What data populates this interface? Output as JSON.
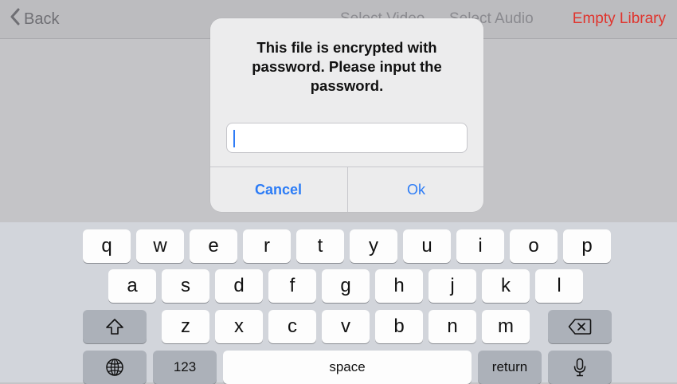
{
  "navbar": {
    "back_label": "Back",
    "select_video_label": "Select Video",
    "select_audio_label": "Select Audio",
    "empty_library_label": "Empty Library"
  },
  "alert": {
    "message": "This file is encrypted with password. Please input the password.",
    "input_value": "",
    "cancel_label": "Cancel",
    "ok_label": "Ok"
  },
  "keyboard": {
    "row1": [
      "q",
      "w",
      "e",
      "r",
      "t",
      "y",
      "u",
      "i",
      "o",
      "p"
    ],
    "row2": [
      "a",
      "s",
      "d",
      "f",
      "g",
      "h",
      "j",
      "k",
      "l"
    ],
    "row3": [
      "z",
      "x",
      "c",
      "v",
      "b",
      "n",
      "m"
    ],
    "numbers_label": "123",
    "space_label": "space",
    "return_label": "return"
  },
  "icons": {
    "back": "chevron-left-icon",
    "shift": "shift-arrow-icon",
    "delete": "backspace-icon",
    "globe": "globe-icon",
    "mic": "microphone-icon"
  },
  "colors": {
    "accent_blue": "#2c7cf6",
    "destructive_red": "#e0332c"
  }
}
